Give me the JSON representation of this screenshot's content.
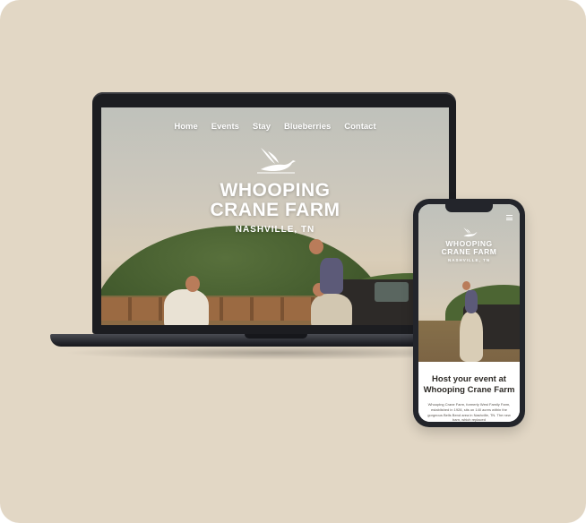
{
  "site": {
    "nav": [
      "Home",
      "Events",
      "Stay",
      "Blueberries",
      "Contact"
    ],
    "logo_line1": "WHOOPING",
    "logo_line2": "CRANE FARM",
    "logo_location": "NASHVILLE, TN"
  },
  "mobile": {
    "heading_line1": "Host your event at",
    "heading_line2": "Whooping Crane Farm",
    "body_text": "Whooping Crane Farm, formerly West Family Farm, established in 1928, sits on 140 acres within the gorgeous Bells Bend area in Nashville, TN. The new barn, which replaced"
  },
  "colors": {
    "background": "#e2d7c5",
    "device": "#1c1d21",
    "text_dark": "#2d2a26"
  },
  "icons": {
    "logo": "crane-bird-icon",
    "menu": "hamburger-menu-icon"
  }
}
